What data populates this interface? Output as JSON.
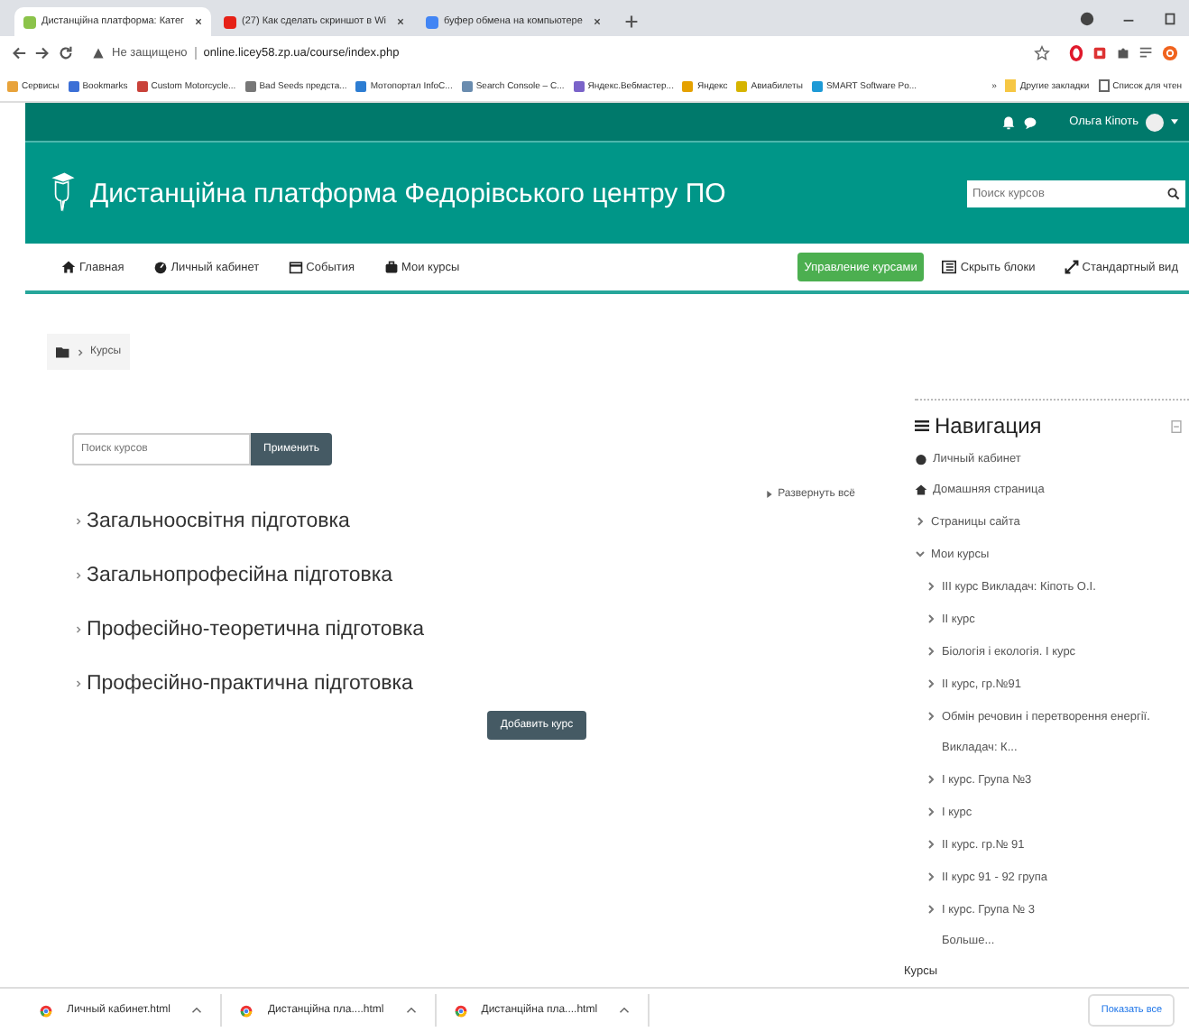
{
  "browser": {
    "tabs": [
      {
        "title": "Дистанційна платформа: Катег",
        "selected": true,
        "color": "#8bc34a"
      },
      {
        "title": "(27) Как сделать скриншот в Wi",
        "selected": false,
        "color": "#e62117"
      },
      {
        "title": "буфер обмена на компьютере",
        "selected": false,
        "color": "#4285f4"
      }
    ],
    "security": "Не защищено",
    "url": "online.licey58.zp.ua/course/index.php",
    "bookmarks": [
      {
        "label": "Сервисы",
        "color": "#e8a33b"
      },
      {
        "label": "Bookmarks",
        "color": "#3b6fd6"
      },
      {
        "label": "Custom Motorcycle...",
        "color": "#c9423a"
      },
      {
        "label": "Bad Seeds предста...",
        "color": "#777777"
      },
      {
        "label": "Мотопортал InfoC...",
        "color": "#2d7dd2"
      },
      {
        "label": "Search Console – C...",
        "color": "#6a8caf"
      },
      {
        "label": "Яндекс.Вебмастер...",
        "color": "#7a63c9"
      },
      {
        "label": "Яндекс",
        "color": "#e5a100"
      },
      {
        "label": "Авиабилеты",
        "color": "#d6b400"
      },
      {
        "label": "SMART Software Po...",
        "color": "#1e9ad6"
      }
    ],
    "more": "»",
    "other_bookmarks": "Другие закладки",
    "reading_list": "Список для чтен"
  },
  "user": {
    "name": "Ольга Кіпоть"
  },
  "site": {
    "title": "Дистанційна платформа Федорівського центру ПО",
    "search_placeholder": "Поиск курсов"
  },
  "nav": [
    {
      "label": "Главная"
    },
    {
      "label": "Личный кабинет"
    },
    {
      "label": "События"
    },
    {
      "label": "Мои курсы"
    }
  ],
  "manage_button": "Управление курсами",
  "hide_blocks": "Скрыть блоки",
  "standard_view": "Стандартный вид",
  "breadcrumb": [
    "Курсы"
  ],
  "course_search": {
    "placeholder": "Поиск курсов",
    "button": "Применить"
  },
  "expand_all": "Развернуть всё",
  "categories": [
    "Загальноосвітня підготовка",
    "Загальнопрофесійна підготовка",
    "Професійно-теоретична підготовка",
    "Професійно-практична підготовка"
  ],
  "add_course": "Добавить курс",
  "navigation": {
    "title": "Навигация",
    "items": [
      {
        "label": "Личный кабинет",
        "kind": "dashboard"
      },
      {
        "label": "Домашняя страница",
        "kind": "home"
      },
      {
        "label": "Страницы сайта",
        "kind": "branch",
        "expanded": false
      },
      {
        "label": "Мои курсы",
        "kind": "branch",
        "expanded": true,
        "children": [
          {
            "label": "III курс Викладач: Кіпоть О.І.",
            "kind": "branch",
            "expanded": false
          },
          {
            "label": "II курс",
            "kind": "branch",
            "expanded": false
          },
          {
            "label": "Біологія і екологія. I курс",
            "kind": "branch",
            "expanded": false
          },
          {
            "label": "II курс, гр.№91",
            "kind": "branch",
            "expanded": false
          },
          {
            "label": "Обмін речовин і перетворення енергії. Викладач: К...",
            "kind": "branch",
            "expanded": false
          },
          {
            "label": "I курс. Група №3",
            "kind": "branch",
            "expanded": false
          },
          {
            "label": "I курс",
            "kind": "branch",
            "expanded": false
          },
          {
            "label": "II курс. гр.№ 91",
            "kind": "branch",
            "expanded": false
          },
          {
            "label": "II курс 91 - 92 група",
            "kind": "branch",
            "expanded": false
          },
          {
            "label": "I курс. Група № 3",
            "kind": "branch",
            "expanded": false
          },
          {
            "label": "Больше...",
            "kind": "leaf"
          }
        ]
      },
      {
        "label": "Курсы",
        "kind": "heading"
      }
    ]
  },
  "downloads": {
    "items": [
      "Личный кабинет.html",
      "Дистанційна пла....html",
      "Дистанційна пла....html"
    ],
    "show_all": "Показать все"
  }
}
